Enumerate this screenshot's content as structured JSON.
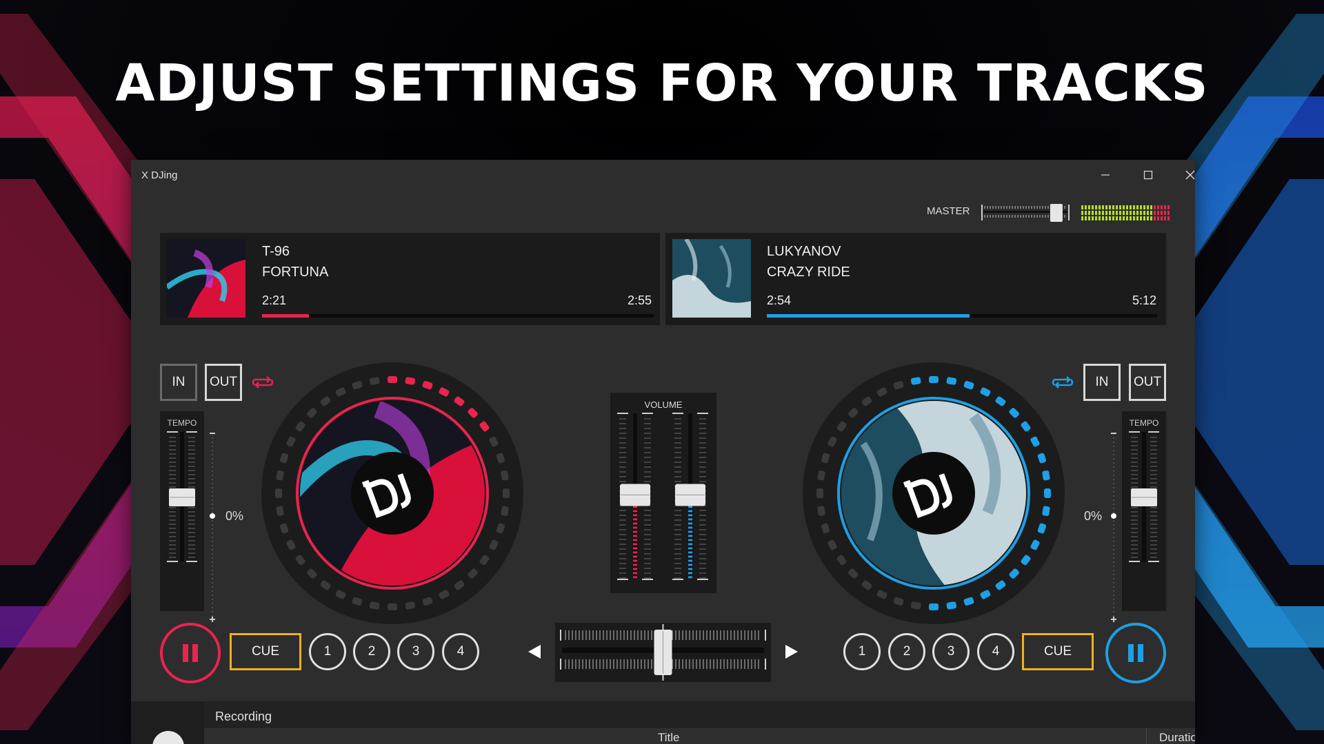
{
  "headline": "ADJUST SETTINGS FOR YOUR TRACKS",
  "window": {
    "title": "X DJing",
    "controls": [
      "minimize-icon",
      "maximize-icon",
      "close-icon"
    ]
  },
  "master": {
    "label": "MASTER",
    "level": 0.85,
    "meter_colors": [
      "#b7e021",
      "#e8244f"
    ]
  },
  "deck_a": {
    "artist": "T-96",
    "title": "FORTUNA",
    "time_current": "2:21",
    "time_total": "2:55",
    "progress": 0.12,
    "accent": "#e8244f",
    "loop_in": "IN",
    "loop_out": "OUT",
    "tempo_label": "TEMPO",
    "tempo_value": "0%",
    "cue": "CUE",
    "hotcues": [
      "1",
      "2",
      "3",
      "4"
    ],
    "play_icon": "pause-icon",
    "platter_logo": "dj-logo-icon"
  },
  "deck_b": {
    "artist": "LUKYANOV",
    "title": "CRAZY RIDE",
    "time_current": "2:54",
    "time_total": "5:12",
    "progress": 0.52,
    "accent": "#1e9fe6",
    "loop_in": "IN",
    "loop_out": "OUT",
    "tempo_label": "TEMPO",
    "tempo_value": "0%",
    "cue": "CUE",
    "hotcues": [
      "1",
      "2",
      "3",
      "4"
    ],
    "play_icon": "pause-icon",
    "platter_logo": "dj-logo-icon"
  },
  "mixer": {
    "volume_label": "VOLUME",
    "volume_a": 0.55,
    "volume_b": 0.55,
    "crossfader": 0.5,
    "left_arrow": "triangle-left-icon",
    "right_arrow": "triangle-right-icon"
  },
  "recording": {
    "label": "Recording",
    "columns": [
      "Title",
      "Duration"
    ]
  }
}
